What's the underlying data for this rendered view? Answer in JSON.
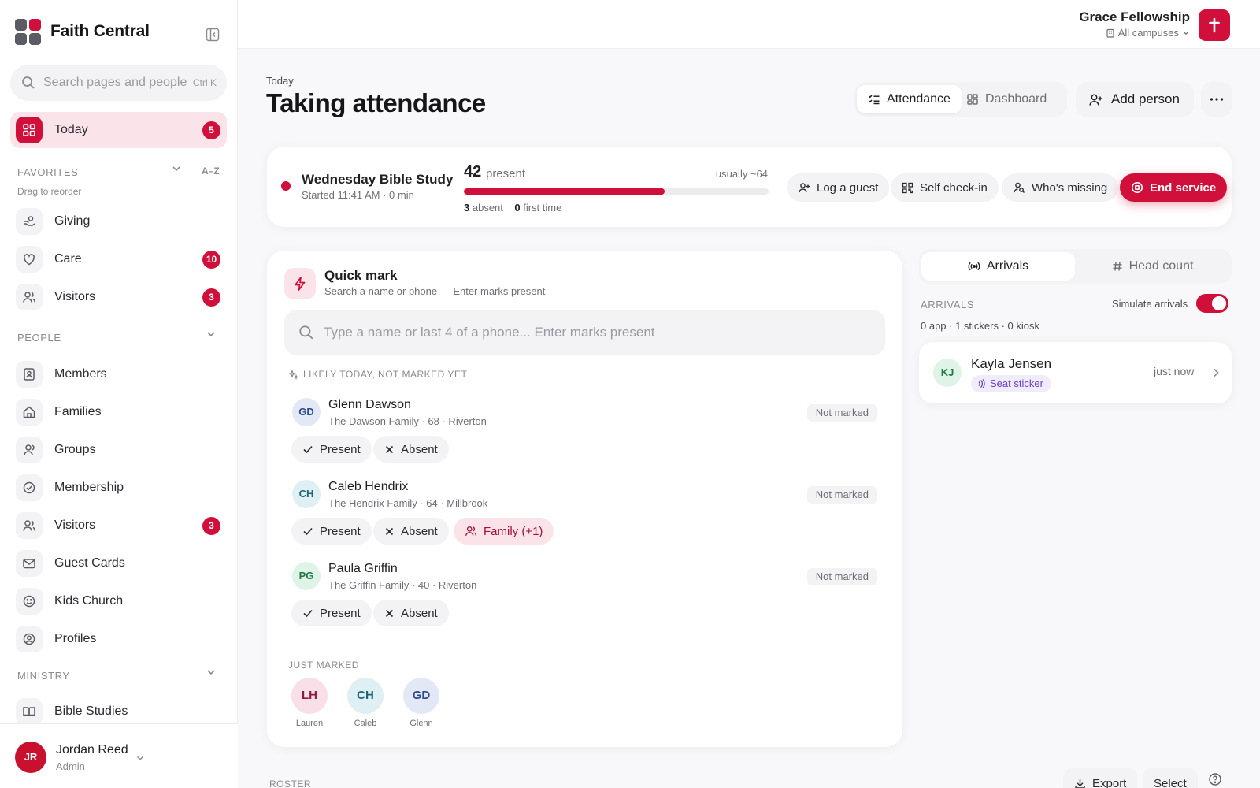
{
  "sidebar": {
    "brand": "Faith Central",
    "search": {
      "placeholder": "Search pages and people",
      "shortcut": "Ctrl K"
    },
    "today": {
      "label": "Today",
      "badge": "5"
    },
    "favorites": {
      "header": "FAVORITES",
      "sort_label": "A–Z",
      "hint": "Drag to reorder",
      "items": [
        {
          "label": "Giving",
          "badge": ""
        },
        {
          "label": "Care",
          "badge": "10"
        },
        {
          "label": "Visitors",
          "badge": "3"
        }
      ]
    },
    "people": {
      "header": "PEOPLE",
      "items": [
        {
          "label": "Members",
          "badge": ""
        },
        {
          "label": "Families",
          "badge": ""
        },
        {
          "label": "Groups",
          "badge": ""
        },
        {
          "label": "Membership",
          "badge": ""
        },
        {
          "label": "Visitors",
          "badge": "3"
        },
        {
          "label": "Guest Cards",
          "badge": ""
        },
        {
          "label": "Kids Church",
          "badge": ""
        },
        {
          "label": "Profiles",
          "badge": ""
        }
      ]
    },
    "ministry": {
      "header": "MINISTRY",
      "items": [
        {
          "label": "Bible Studies"
        }
      ]
    },
    "user": {
      "initials": "JR",
      "name": "Jordan Reed",
      "role": "Admin"
    }
  },
  "header": {
    "org_name": "Grace Fellowship",
    "campus": "All campuses"
  },
  "page": {
    "breadcrumb": "Today",
    "title": "Taking attendance",
    "view_tabs": [
      {
        "label": "Attendance",
        "active": true
      },
      {
        "label": "Dashboard",
        "active": false
      }
    ],
    "add_person_label": "Add person"
  },
  "service": {
    "name": "Wednesday Bible Study",
    "started": "Started 11:41 AM · 0 min",
    "present_count": "42",
    "present_label": "present",
    "usually": "usually ~64",
    "progress": 0.66,
    "absent_count": "3",
    "absent_label": "absent",
    "first_time_count": "0",
    "first_time_label": "first time",
    "actions": {
      "log_guest": "Log a guest",
      "self_checkin": "Self check-in",
      "whos_missing": "Who's missing",
      "end_service": "End service"
    }
  },
  "quick_mark": {
    "title": "Quick mark",
    "subtitle": "Search a name or phone — Enter marks present",
    "search_placeholder": "Type a name or last 4 of a phone... Enter marks present",
    "likely_header": "LIKELY TODAY, NOT MARKED YET",
    "present_label": "Present",
    "absent_label": "Absent",
    "people": [
      {
        "initials": "GD",
        "name": "Glenn Dawson",
        "meta": "The Dawson Family · 68 · Riverton",
        "status": "Not marked",
        "family": ""
      },
      {
        "initials": "CH",
        "name": "Caleb Hendrix",
        "meta": "The Hendrix Family · 64 · Millbrook",
        "status": "Not marked",
        "family": "Family (+1)"
      },
      {
        "initials": "PG",
        "name": "Paula Griffin",
        "meta": "The Griffin Family · 40 · Riverton",
        "status": "Not marked",
        "family": ""
      }
    ],
    "just_marked_header": "JUST MARKED",
    "just_marked": [
      {
        "initials": "LH",
        "name": "Lauren"
      },
      {
        "initials": "CH",
        "name": "Caleb"
      },
      {
        "initials": "GD",
        "name": "Glenn"
      }
    ]
  },
  "arrivals": {
    "tabs": [
      {
        "label": "Arrivals",
        "active": true
      },
      {
        "label": "Head count",
        "active": false
      }
    ],
    "header": "ARRIVALS",
    "simulate_label": "Simulate arrivals",
    "simulate_on": true,
    "counts": "0 app · 1 stickers · 0 kiosk",
    "items": [
      {
        "initials": "KJ",
        "name": "Kayla Jensen",
        "tag": "Seat sticker",
        "time": "just now"
      }
    ]
  },
  "roster": {
    "header": "ROSTER",
    "export_label": "Export",
    "select_label": "Select"
  },
  "colors": {
    "accent": "#d0103a",
    "accent_soft": "#fbe4e9",
    "surface": "#f3f3f5",
    "text": "#1f1f24",
    "muted": "#6e6e76"
  }
}
